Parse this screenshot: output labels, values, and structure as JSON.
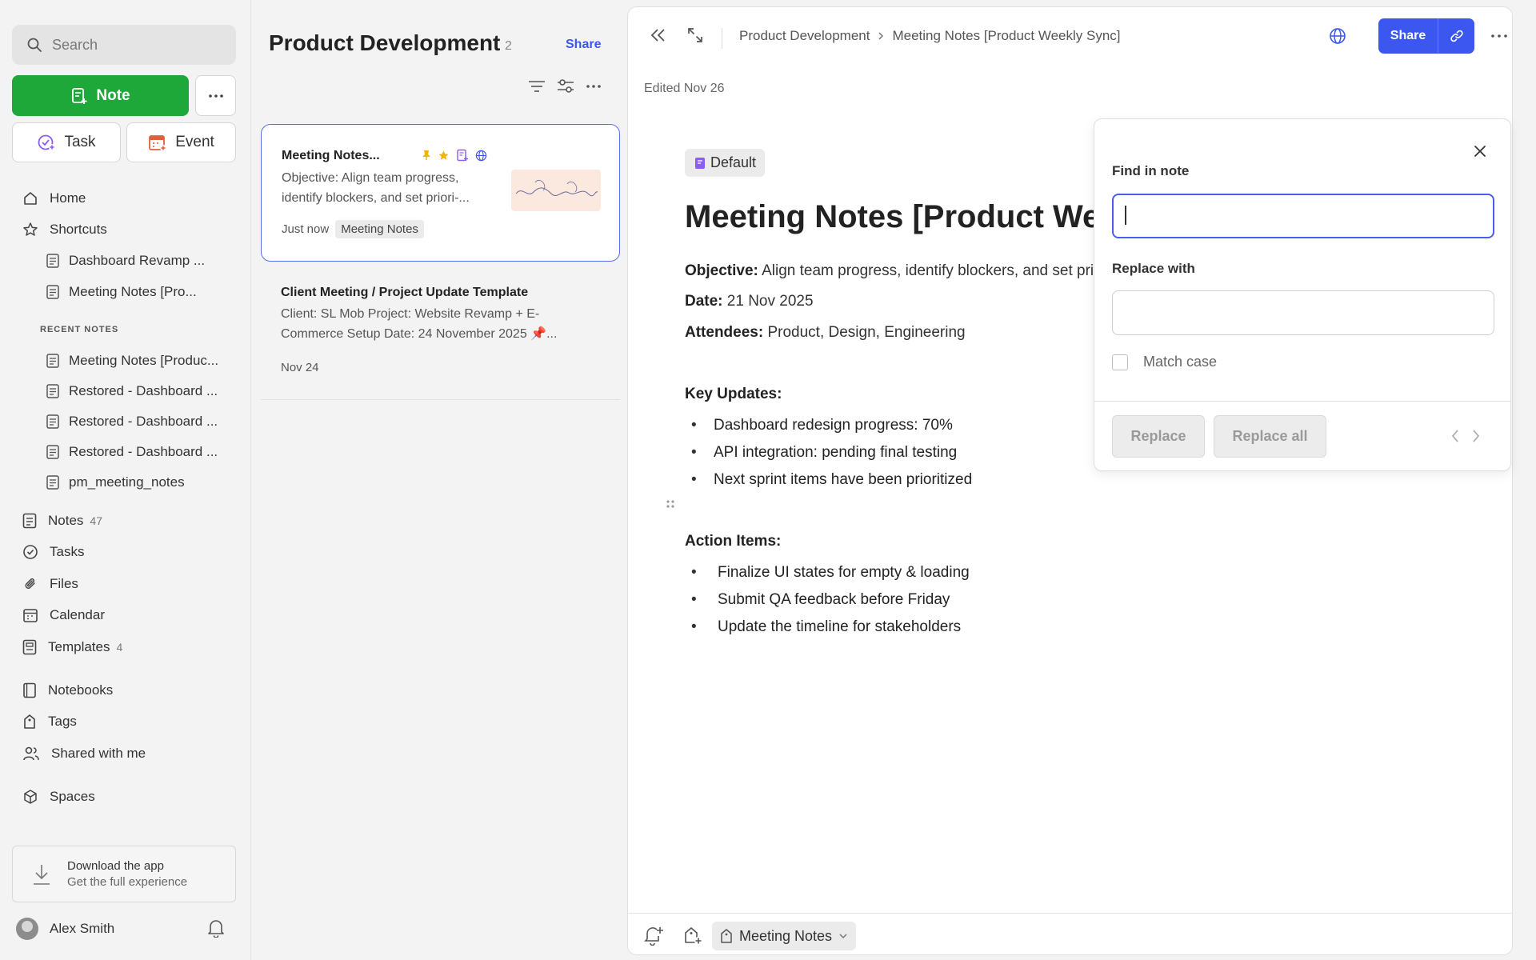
{
  "sidebar": {
    "search_placeholder": "Search",
    "note_label": "Note",
    "task_label": "Task",
    "event_label": "Event",
    "nav": {
      "home": "Home",
      "shortcuts": "Shortcuts",
      "notes": "Notes",
      "notes_count": "47",
      "tasks": "Tasks",
      "files": "Files",
      "calendar": "Calendar",
      "templates": "Templates",
      "templates_count": "4",
      "notebooks": "Notebooks",
      "tags": "Tags",
      "shared": "Shared with me",
      "spaces": "Spaces"
    },
    "shortcut_items": [
      "Dashboard Revamp ...",
      "Meeting Notes [Pro..."
    ],
    "recent_label": "RECENT NOTES",
    "recent_items": [
      "Meeting Notes [Produc...",
      "Restored - Dashboard ...",
      "Restored - Dashboard ...",
      "Restored - Dashboard ...",
      "pm_meeting_notes"
    ],
    "download_title": "Download the app",
    "download_subtitle": "Get the full experience",
    "user_name": "Alex Smith"
  },
  "list": {
    "title": "Product Development",
    "count": "2",
    "share_label": "Share",
    "notes": [
      {
        "title": "Meeting Notes...",
        "snippet": "Objective: Align team progress, identify blockers, and set priori-...",
        "time": "Just now",
        "tag": "Meeting Notes"
      },
      {
        "title": "Client Meeting / Project Update Template",
        "snippet": "Client: SL Mob Project: Website Revamp + E-Commerce Setup Date: 24 November 2025 📌...",
        "time": "Nov 24"
      }
    ]
  },
  "editor": {
    "breadcrumb": [
      "Product Development",
      "Meeting Notes [Product Weekly Sync]"
    ],
    "share_label": "Share",
    "edited": "Edited Nov 26",
    "template_tag": "Default",
    "title": "Meeting Notes [Product Weekly Sync]",
    "objective_label": "Objective:",
    "objective_text": " Align team progress, identify blockers, and set priorities",
    "date_label": "Date:",
    "date_text": " 21 Nov 2025",
    "attendees_label": "Attendees:",
    "attendees_text": " Product, Design, Engineering",
    "key_updates_heading": "Key Updates:",
    "key_updates": [
      "Dashboard redesign progress: 70%",
      "API integration: pending final testing",
      "Next sprint items have been prioritized"
    ],
    "action_items_heading": "Action Items:",
    "action_items": [
      "Finalize UI states for empty & loading",
      "Submit QA feedback before Friday",
      "Update the timeline for stakeholders"
    ],
    "footer_tag": "Meeting Notes"
  },
  "find_replace": {
    "find_label": "Find in note",
    "find_value": "",
    "replace_label": "Replace with",
    "replace_value": "",
    "match_case_label": "Match case",
    "replace_label_btn": "Replace",
    "replace_all_label": "Replace all"
  },
  "colors": {
    "accent": "#3b57ef",
    "note_button": "#1ea83a"
  }
}
